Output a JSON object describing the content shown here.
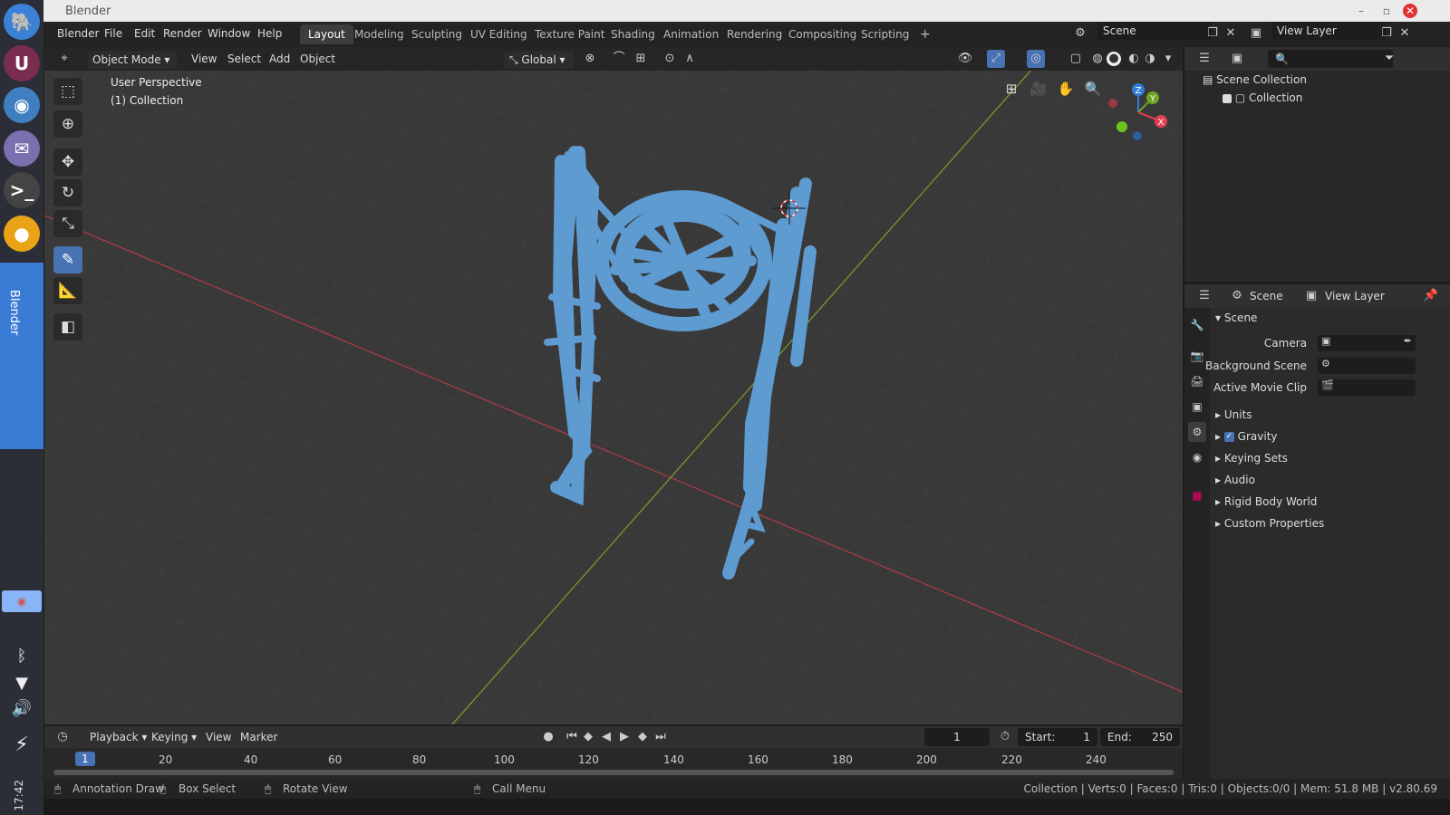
{
  "dock": {
    "apps": [
      {
        "icon": "mastodon-icon",
        "color": "#3b82d6"
      },
      {
        "icon": "u-app-icon",
        "label": "U",
        "color": "#7b2d4f"
      },
      {
        "icon": "blender-icon",
        "color": "#3f7fbf"
      },
      {
        "icon": "inbox-icon",
        "color": "#7b6fb0"
      },
      {
        "icon": "terminal-icon",
        "color": "#444"
      },
      {
        "icon": "chrome-icon",
        "color": "#e8a317"
      }
    ],
    "active_label": "Blender",
    "clock": "17:42"
  },
  "titlebar": {
    "title": "Blender"
  },
  "menus": [
    "Blender",
    "File",
    "Edit",
    "Render",
    "Window",
    "Help"
  ],
  "workspaces": [
    "Layout",
    "Modeling",
    "Sculpting",
    "UV Editing",
    "Texture Paint",
    "Shading",
    "Animation",
    "Rendering",
    "Compositing",
    "Scripting"
  ],
  "active_workspace": "Layout",
  "scene_field": "Scene",
  "view_layer_field": "View Layer",
  "viewport_header": {
    "mode": "Object Mode",
    "menus": [
      "View",
      "Select",
      "Add",
      "Object"
    ],
    "orientation": "Global"
  },
  "viewport": {
    "perspective": "User Perspective",
    "collection": "(1) Collection",
    "stroke_color": "#5e9bd1",
    "gizmo": {
      "z": "Z",
      "y": "Y",
      "x": "X"
    }
  },
  "outliner": {
    "scene_collection": "Scene Collection",
    "collection": "Collection"
  },
  "properties": {
    "tabs_header": {
      "scene": "Scene",
      "view_layer": "View Layer"
    },
    "panel": "Scene",
    "rows": [
      {
        "label": "Camera"
      },
      {
        "label": "Background Scene"
      },
      {
        "label": "Active Movie Clip"
      }
    ],
    "subpanels": [
      "Units",
      "Gravity",
      "Keying Sets",
      "Audio",
      "Rigid Body World",
      "Custom Properties"
    ]
  },
  "timeline": {
    "menus": [
      "Playback",
      "Keying",
      "View",
      "Marker"
    ],
    "current_frame": "1",
    "start_label": "Start:",
    "start": "1",
    "end_label": "End:",
    "end": "250",
    "ticks": [
      "1",
      "20",
      "40",
      "60",
      "80",
      "100",
      "120",
      "140",
      "160",
      "180",
      "200",
      "220",
      "240"
    ]
  },
  "statusbar": {
    "left1": "Annotation Draw",
    "left2": "Box Select",
    "left3": "Rotate View",
    "left4": "Call Menu",
    "right": "Collection | Verts:0 | Faces:0 | Tris:0 | Objects:0/0 | Mem: 51.8 MB | v2.80.69"
  }
}
